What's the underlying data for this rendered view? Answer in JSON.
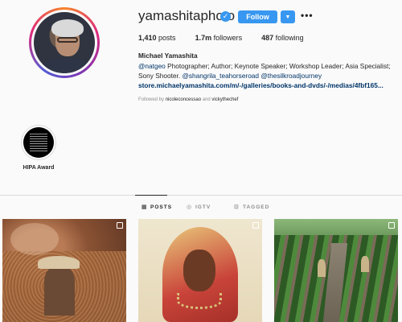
{
  "profile": {
    "username": "yamashitaphoto",
    "verified_icon": "✓",
    "follow_label": "Follow",
    "dropdown_icon": "▼",
    "more_icon": "•••",
    "stats": {
      "posts_count": "1,410",
      "posts_label": "posts",
      "followers_count": "1.7m",
      "followers_label": "followers",
      "following_count": "487",
      "following_label": "following"
    },
    "bio": {
      "name": "Michael Yamashita",
      "line1_tag": "@natgeo",
      "line1_text": " Photographer; Author; Keynote Speaker; Workshop Leader; Asia Specialist;",
      "line2_text": "Sony Shooter. ",
      "line2_tag1": "@shangrila_teahorseroad",
      "line2_tag2": "@thesilkroadjourney",
      "link": "store.michaelyamashita.com/m/-/galleries/books-and-dvds/-/medias/4fbf165..."
    },
    "followed_by": {
      "prefix": "Followed by ",
      "user1": "nicoleconcessao",
      "joiner": " and ",
      "user2": "vickythechef"
    }
  },
  "highlights": [
    {
      "label": "HIPA Award"
    }
  ],
  "tabs": [
    {
      "label": "POSTS",
      "icon": "grid-icon",
      "glyph": "▦",
      "active": true
    },
    {
      "label": "IGTV",
      "icon": "igtv-icon",
      "glyph": "◎",
      "active": false
    },
    {
      "label": "TAGGED",
      "icon": "tagged-icon",
      "glyph": "⊡",
      "active": false
    }
  ],
  "colors": {
    "accent": "#3897f0",
    "background": "#fafafa",
    "text": "#262626",
    "muted": "#8e8e8e",
    "link": "#003569"
  }
}
